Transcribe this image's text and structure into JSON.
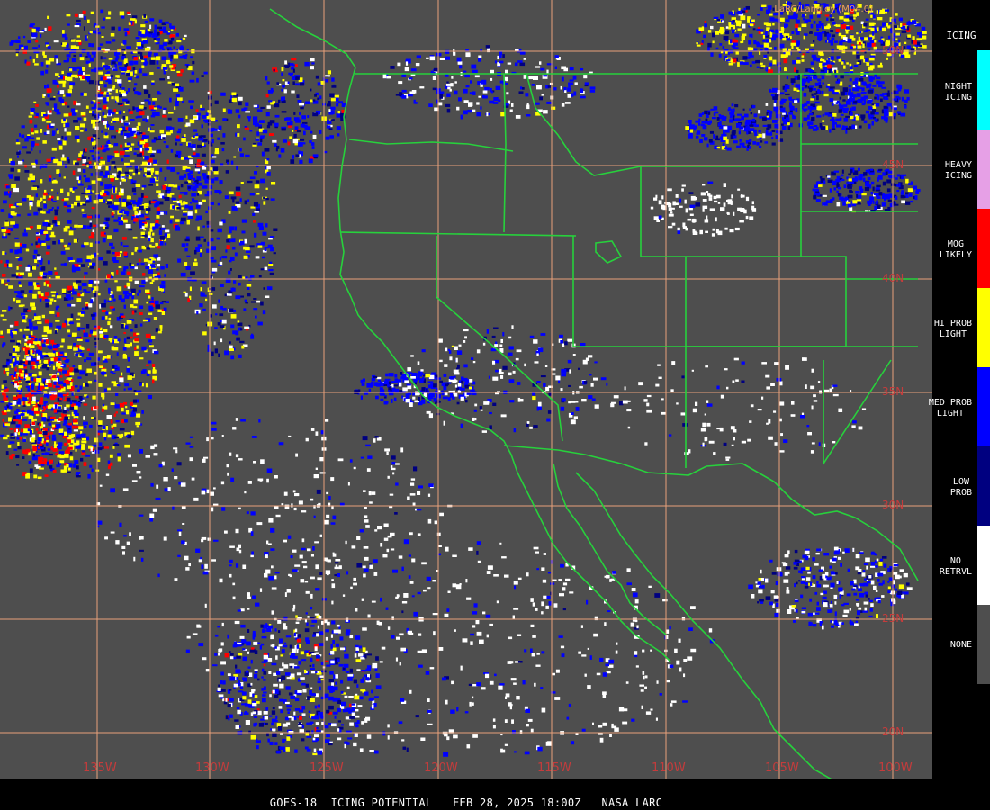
{
  "product": {
    "footer": "GOES-18  ICING POTENTIAL   FEB 28, 2025 18:00Z   NASA LARC",
    "credit": "LaRC/Langley (M04.0)"
  },
  "legend": {
    "title": "ICING",
    "categories": [
      {
        "label": "NIGHT\nICING",
        "color": "#00ffff"
      },
      {
        "label": "HEAVY\nICING",
        "color": "#e6a0e6"
      },
      {
        "label": "MOG\nLIKELY",
        "color": "#ff0000"
      },
      {
        "label": "HI PROB\nLIGHT",
        "color": "#ffff00"
      },
      {
        "label": "MED PROB\nLIGHT",
        "color": "#0000ff"
      },
      {
        "label": "LOW\nPROB",
        "color": "#000080"
      },
      {
        "label": "NO\nRETRVL",
        "color": "#ffffff"
      },
      {
        "label": "NONE",
        "color": "#4e4e4e"
      }
    ]
  },
  "grid": {
    "lon_labels": [
      "135W",
      "130W",
      "125W",
      "120W",
      "115W",
      "110W",
      "105W",
      "100W"
    ],
    "lat_labels": [
      "50N",
      "45N",
      "40N",
      "35N",
      "30N",
      "25N",
      "20N"
    ]
  },
  "colors": {
    "background": "#4e4e4e",
    "gridline": "#e8a07a",
    "boundary": "#27d13c",
    "label": "#c43c3c"
  }
}
